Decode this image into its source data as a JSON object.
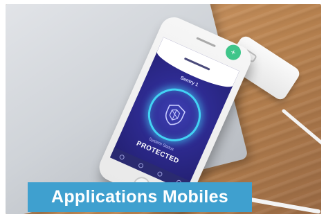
{
  "banner": {
    "title": "Applications Mobiles"
  },
  "phone_screen": {
    "device_name": "Sentry 1",
    "status_label": "System Status",
    "status_value": "PROTECTED",
    "shield_icon": "shield-icon",
    "fab_icon": "plus-icon"
  },
  "colors": {
    "banner_background": "#3fa0cf",
    "banner_text": "#ffffff",
    "screen_background": "#2d2a8f",
    "ring_glow": "#43d3f5",
    "fab": "#3fc58a"
  }
}
